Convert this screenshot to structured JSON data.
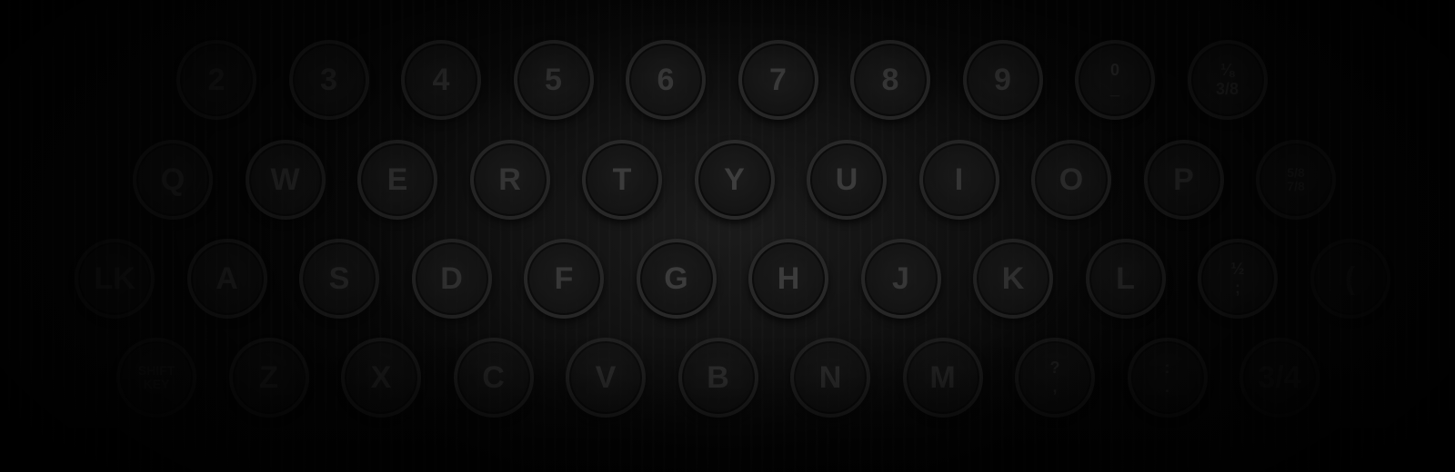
{
  "keyboard": {
    "rows": [
      {
        "keys": [
          {
            "label": "2"
          },
          {
            "label": "3"
          },
          {
            "label": "4"
          },
          {
            "label": "5"
          },
          {
            "label": "6"
          },
          {
            "label": "7"
          },
          {
            "label": "8"
          },
          {
            "label": "9"
          },
          {
            "label": "0\n_"
          },
          {
            "label": "⅛\n3/8"
          }
        ]
      },
      {
        "keys": [
          {
            "label": "Q"
          },
          {
            "label": "W"
          },
          {
            "label": "E"
          },
          {
            "label": "R"
          },
          {
            "label": "T"
          },
          {
            "label": "Y"
          },
          {
            "label": "U"
          },
          {
            "label": "I"
          },
          {
            "label": "O"
          },
          {
            "label": "P"
          },
          {
            "label": "5/8\n7/8"
          }
        ]
      },
      {
        "keys": [
          {
            "label": "LK"
          },
          {
            "label": "A"
          },
          {
            "label": "S"
          },
          {
            "label": "D"
          },
          {
            "label": "F"
          },
          {
            "label": "G"
          },
          {
            "label": "H"
          },
          {
            "label": "J"
          },
          {
            "label": "K"
          },
          {
            "label": "L"
          },
          {
            "label": "½\n;"
          },
          {
            "label": "("
          }
        ]
      },
      {
        "keys": [
          {
            "label": "SHIFT\nKEY"
          },
          {
            "label": "Z"
          },
          {
            "label": "X"
          },
          {
            "label": "C"
          },
          {
            "label": "V"
          },
          {
            "label": "B"
          },
          {
            "label": "N"
          },
          {
            "label": "M"
          },
          {
            "label": "?\n,"
          },
          {
            "label": ":\n."
          },
          {
            "label": "3/4"
          }
        ]
      }
    ]
  }
}
